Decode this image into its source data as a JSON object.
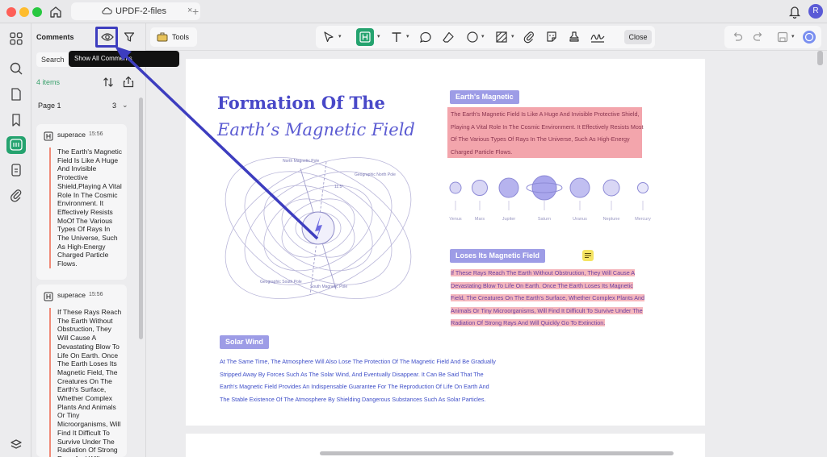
{
  "window": {
    "tab_title": "UPDF-2-files",
    "tab_close": "×",
    "tab_add": "+",
    "avatar_letter": "R"
  },
  "panel": {
    "title": "Comments",
    "search_label": "Search",
    "tooltip": "Show All Comments",
    "count_label": "4 items",
    "page_label": "Page 1",
    "page_count": "3",
    "comments": [
      {
        "author": "superace",
        "time": "15:56",
        "text": "The Earth's Magnetic Field Is Like A Huge And Invisible Protective Shield,Playing A Vital Role In The Cosmic Environment. It Effectively Resists MoOf The Various Types Of Rays In The Universe, Such As High-Energy Charged Particle Flows."
      },
      {
        "author": "superace",
        "time": "15:56",
        "text": "If These Rays Reach The Earth Without Obstruction, They Will Cause A Devastating Blow To Life On Earth. Once The Earth Loses Its Magnetic Field, The Creatures On The Earth's Surface, Whether Complex Plants And Animals Or Tiny Microorganisms, Will Find It Difficult To Survive Under The Radiation Of Strong Rays And Will"
      }
    ]
  },
  "toolbar": {
    "tools_label": "Tools",
    "close_label": "Close"
  },
  "document": {
    "title_line1": "Formation Of The",
    "title_line2": "Earth’s Magnetic Field",
    "section1_tag": "Earth's Magnetic",
    "section1_lines": [
      "The Earth's Magnetic Field Is Like A Huge And Invisible Protective Shield,",
      "Playing A Vital Role In The Cosmic Environment. It Effectively Resists Most",
      "Of The Various Types Of Rays In The Universe, Such As High-Energy",
      "Charged Particle Flows."
    ],
    "planets": [
      "Venus",
      "Mars",
      "Jupiter",
      "Saturn",
      "Uranus",
      "Neptune",
      "Mercury"
    ],
    "section2_tag": "Loses Its Magnetic Field",
    "section2_lines": [
      "If These Rays Reach The Earth Without Obstruction, They Will Cause A",
      "Devastating Blow To Life On Earth. Once The Earth Loses Its Magnetic",
      "Field, The Creatures On The Earth's Surface, Whether Complex Plants And",
      "Animals Or Tiny Microorganisms, Will Find It Difficult To Survive Under The",
      "Radiation Of Strong Rays And Will Quickly Go To Extinction."
    ],
    "section3_tag": "Solar Wind",
    "section3_lines": [
      "At The Same Time, The Atmosphere Will Also Lose The Protection Of The Magnetic Field And Be Gradually",
      "Stripped Away By Forces Such As The Solar Wind, And Eventually Disappear. It Can Be Said That The",
      "Earth's Magnetic Field Provides An Indispensable Guarantee For The Reproduction Of Life On Earth And",
      "The Stable Existence Of The Atmosphere By Shielding Dangerous Substances Such As Solar Particles."
    ],
    "diagram_labels": {
      "north_magnetic": "North Magnetic Pole",
      "geo_north": "Geographic North Pole",
      "angle": "11.5°",
      "geo_south": "Geographic South Pole",
      "south_magnetic": "South Magnetic Pole"
    }
  },
  "colors": {
    "accent_green": "#25a36f",
    "annotation_blue": "#3d3dbf",
    "title_purple": "#4848c8"
  }
}
